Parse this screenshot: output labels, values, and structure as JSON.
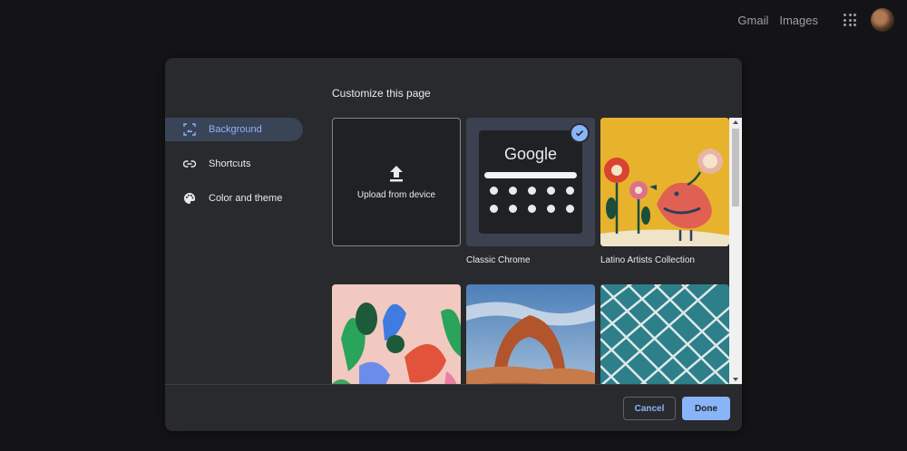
{
  "topbar": {
    "gmail": "Gmail",
    "images": "Images"
  },
  "dialog": {
    "title": "Customize this page",
    "nav": [
      {
        "label": "Background",
        "icon": "background-icon",
        "active": true
      },
      {
        "label": "Shortcuts",
        "icon": "link-icon",
        "active": false
      },
      {
        "label": "Color and theme",
        "icon": "palette-icon",
        "active": false
      }
    ],
    "tiles": {
      "upload_label": "Upload from device",
      "classic_logo": "Google",
      "classic_label": "Classic Chrome",
      "latino_label": "Latino Artists Collection"
    },
    "buttons": {
      "cancel": "Cancel",
      "done": "Done"
    }
  },
  "colors": {
    "accent": "#8ab4f8",
    "dialog_bg": "#292a2d",
    "page_bg": "#141416"
  }
}
